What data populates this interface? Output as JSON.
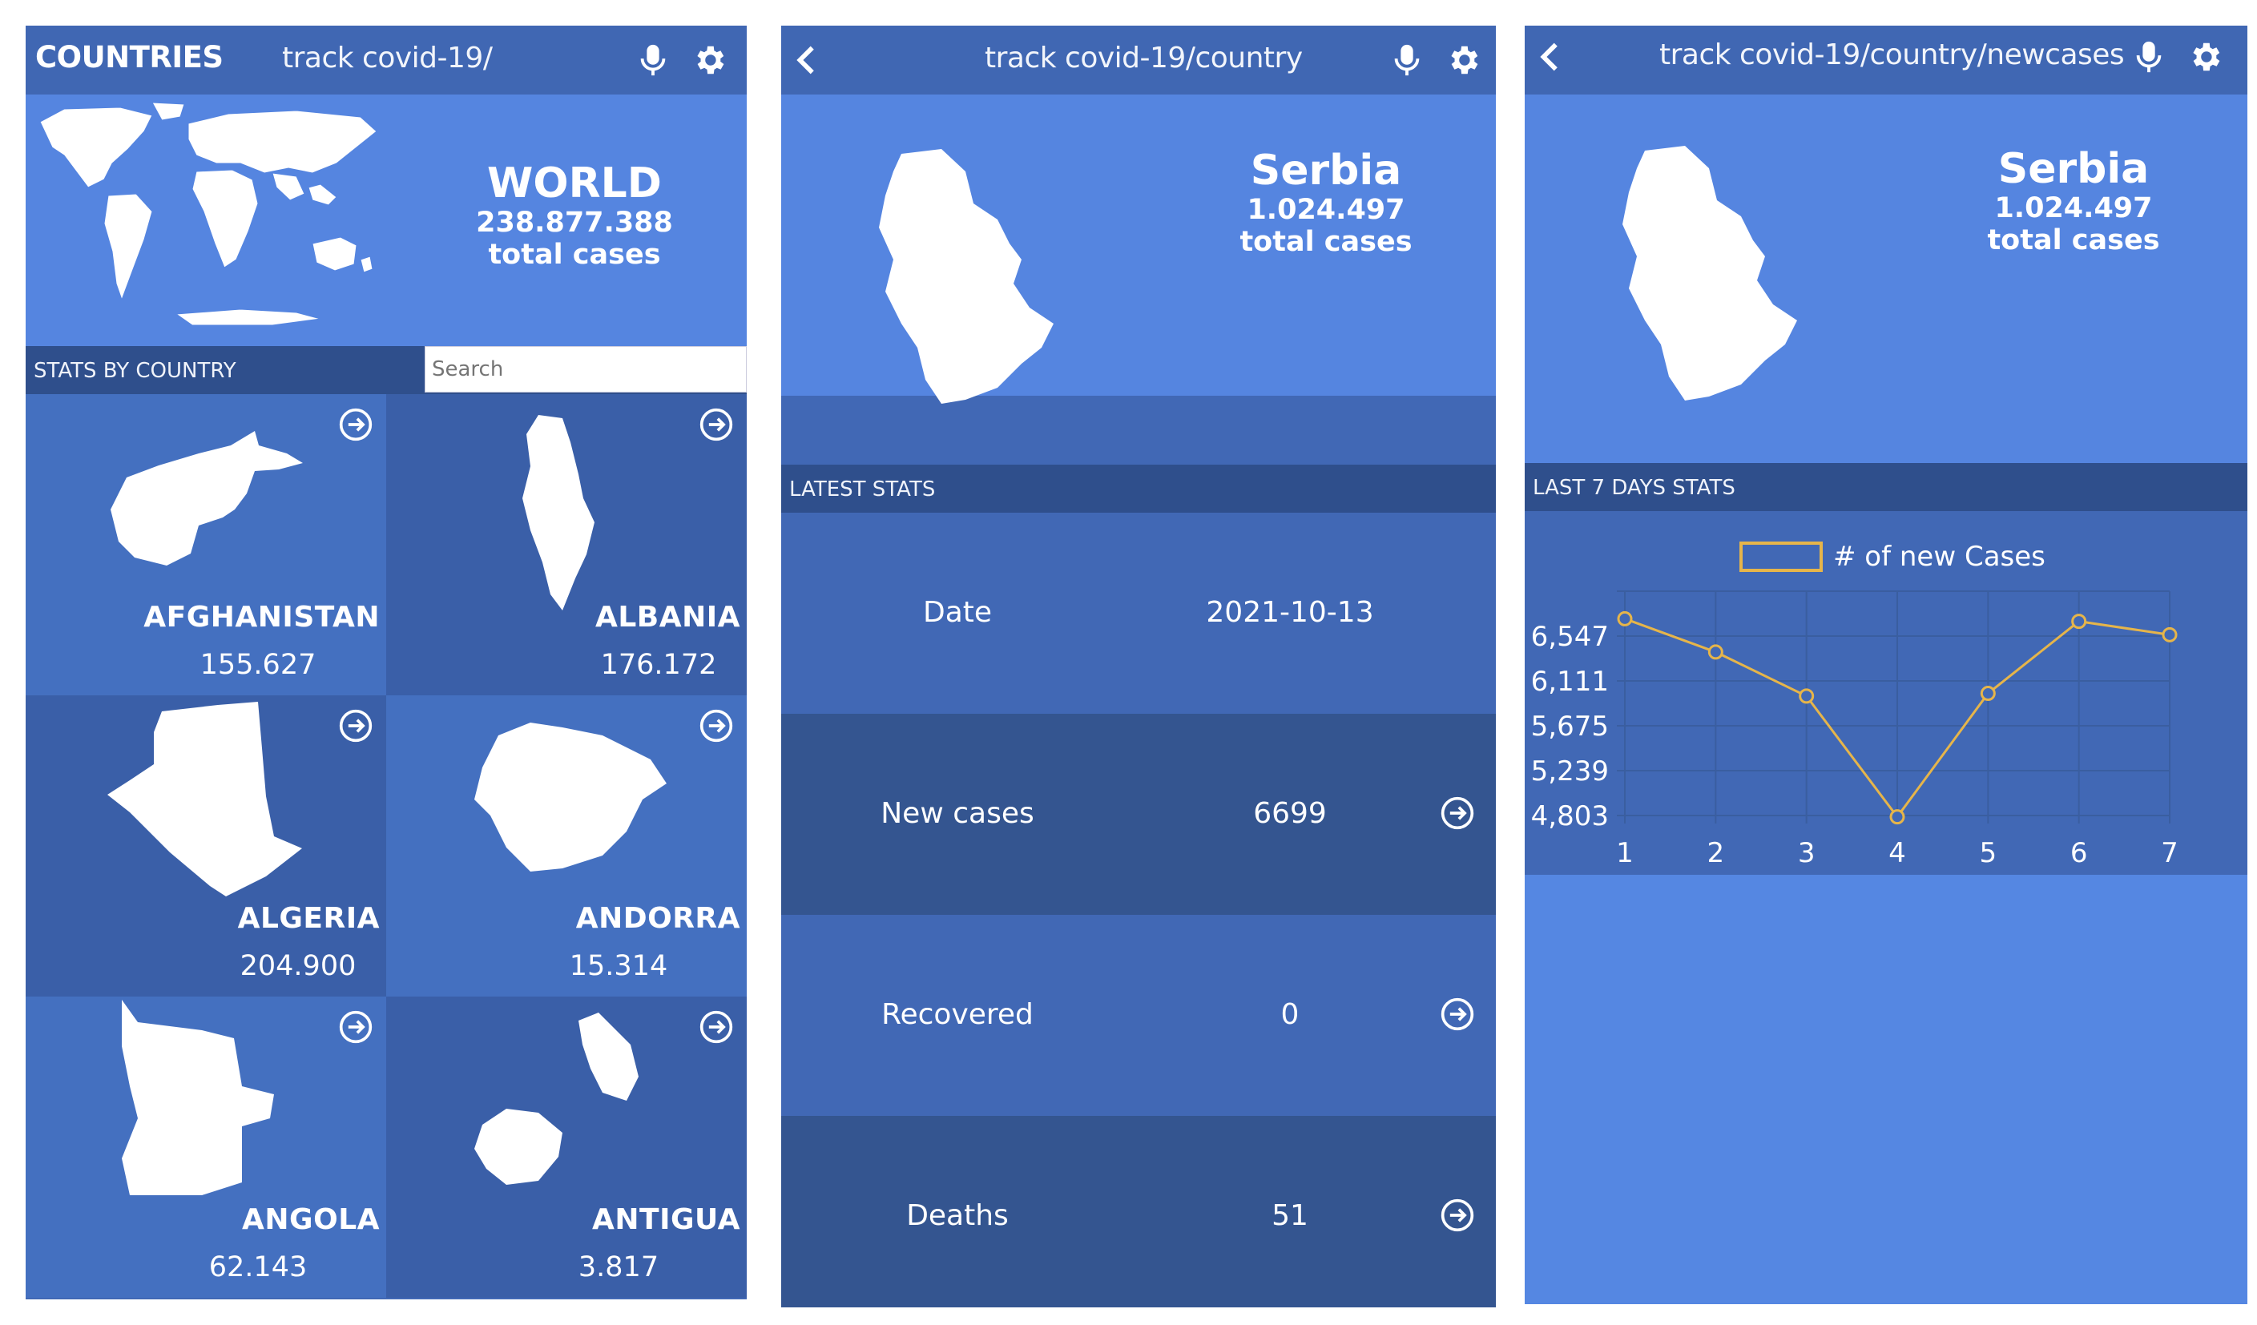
{
  "panel1": {
    "title": "COUNTRIES",
    "path": "track covid-19/",
    "world": {
      "name": "WORLD",
      "total": "238.877.388",
      "label": "total cases"
    },
    "section": "STATS BY COUNTRY",
    "search_placeholder": "Search",
    "countries": [
      {
        "name": "AFGHANISTAN",
        "count": "155.627"
      },
      {
        "name": "ALBANIA",
        "count": "176.172"
      },
      {
        "name": "ALGERIA",
        "count": "204.900"
      },
      {
        "name": "ANDORRA",
        "count": "15.314"
      },
      {
        "name": "ANGOLA",
        "count": "62.143"
      },
      {
        "name": "ANTIGUA",
        "count": "3.817"
      }
    ]
  },
  "panel2": {
    "path": "track covid-19/country",
    "country": {
      "name": "Serbia",
      "total": "1.024.497",
      "label": "total cases"
    },
    "section": "LATEST STATS",
    "stats": [
      {
        "key": "Date",
        "value": "2021-10-13"
      },
      {
        "key": "New cases",
        "value": "6699"
      },
      {
        "key": "Recovered",
        "value": "0"
      },
      {
        "key": "Deaths",
        "value": "51"
      }
    ]
  },
  "panel3": {
    "path": "track covid-19/country/newcases",
    "country": {
      "name": "Serbia",
      "total": "1.024.497",
      "label": "total cases"
    },
    "section": "LAST 7 DAYS STATS"
  },
  "icons": {
    "mic": "microphone-icon",
    "settings": "gear-icon",
    "back": "chevron-left-icon",
    "go": "arrow-right-circle-icon"
  },
  "colors": {
    "bar": "#4067b3",
    "hero": "#5585e0",
    "section": "#2f4f8c",
    "line": "#e6b54a"
  },
  "chart_data": {
    "type": "line",
    "x": [
      1,
      2,
      3,
      4,
      5,
      6,
      7
    ],
    "series": [
      {
        "name": "# of new Cases",
        "values": [
          6715,
          6392,
          5964,
          4790,
          5990,
          6690,
          6560
        ]
      }
    ],
    "yticks": [
      "4,803",
      "5,239",
      "5,675",
      "6,111",
      "6,547"
    ],
    "xticks": [
      "1",
      "2",
      "3",
      "4",
      "5",
      "6",
      "7"
    ],
    "ylim": [
      4803,
      6983
    ],
    "grid": true,
    "legend": "top"
  }
}
